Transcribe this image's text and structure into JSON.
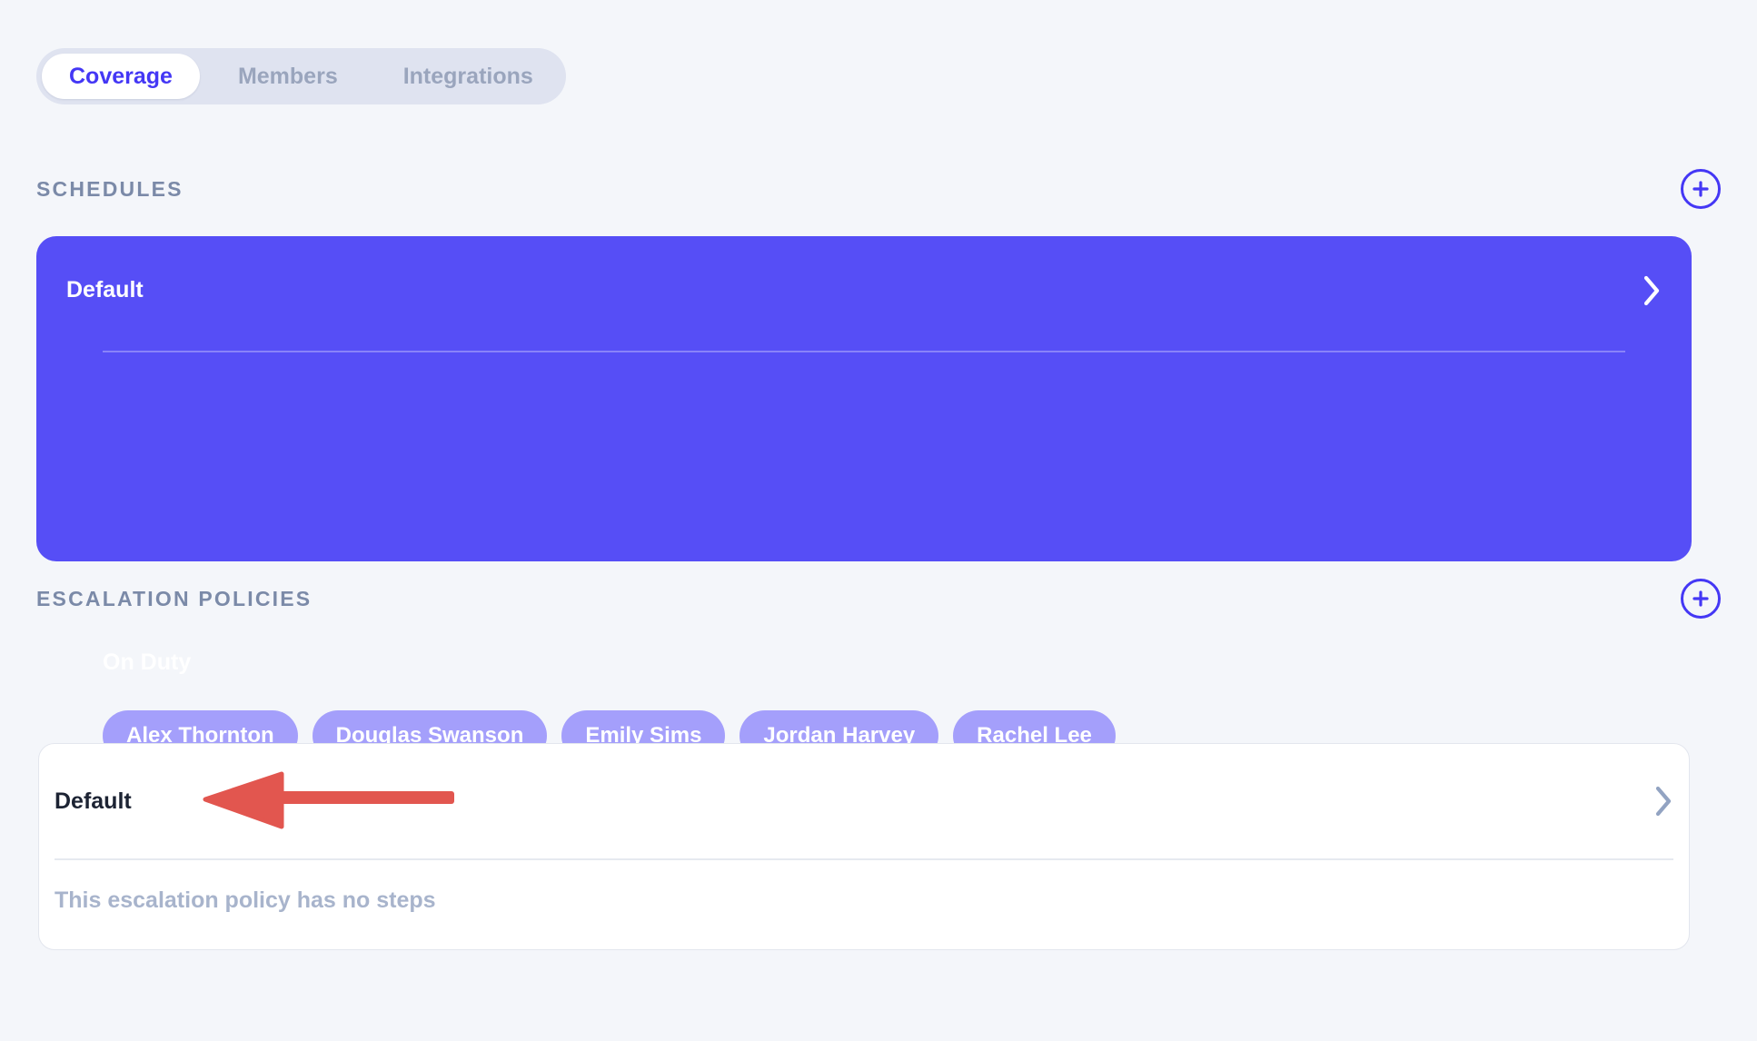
{
  "tabs": [
    {
      "label": "Coverage",
      "active": true
    },
    {
      "label": "Members",
      "active": false
    },
    {
      "label": "Integrations",
      "active": false
    }
  ],
  "schedules_section": {
    "title": "SCHEDULES",
    "add_icon": "plus-circle-icon",
    "card": {
      "name": "Default",
      "chevron_icon": "chevron-right-icon",
      "on_duty_label": "On Duty",
      "on_duty_members": [
        "Alex Thornton",
        "Douglas Swanson",
        "Emily Sims",
        "Jordan Harvey",
        "Rachel Lee"
      ]
    }
  },
  "escalation_section": {
    "title": "ESCALATION POLICIES",
    "add_icon": "plus-circle-icon",
    "card": {
      "name": "Default",
      "chevron_icon": "chevron-right-icon",
      "empty_message": "This escalation policy has no steps"
    }
  },
  "annotation": {
    "type": "arrow-left",
    "color": "#e2564f",
    "points_at": "Default"
  },
  "colors": {
    "page_background": "#f4f6fa",
    "accent_indigo": "#4437f5",
    "card_purple": "#564ef6",
    "pill_purple": "#a49ffb",
    "tabbar_background": "#dfe3f0",
    "muted_text": "#7b8aa8",
    "empty_text": "#a8b4cc",
    "annotation_red": "#e2564f"
  }
}
